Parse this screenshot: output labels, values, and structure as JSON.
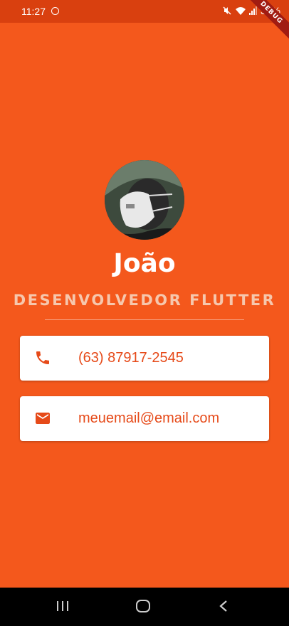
{
  "status_bar": {
    "time": "11:27",
    "battery": "36%",
    "debug_label": "DEBUG"
  },
  "profile": {
    "name": "João",
    "role": "DESENVOLVEDOR FLUTTER"
  },
  "contacts": [
    {
      "icon": "phone-icon",
      "text": "(63) 87917-2545"
    },
    {
      "icon": "email-icon",
      "text": "meuemail@email.com"
    }
  ],
  "colors": {
    "background": "#f4581c",
    "status_bar": "#d9400f",
    "accent_text": "#e64a19",
    "role_text": "#f6c7ad"
  },
  "nav_bar": {
    "buttons": [
      "recent-apps-icon",
      "home-icon",
      "back-icon"
    ]
  }
}
